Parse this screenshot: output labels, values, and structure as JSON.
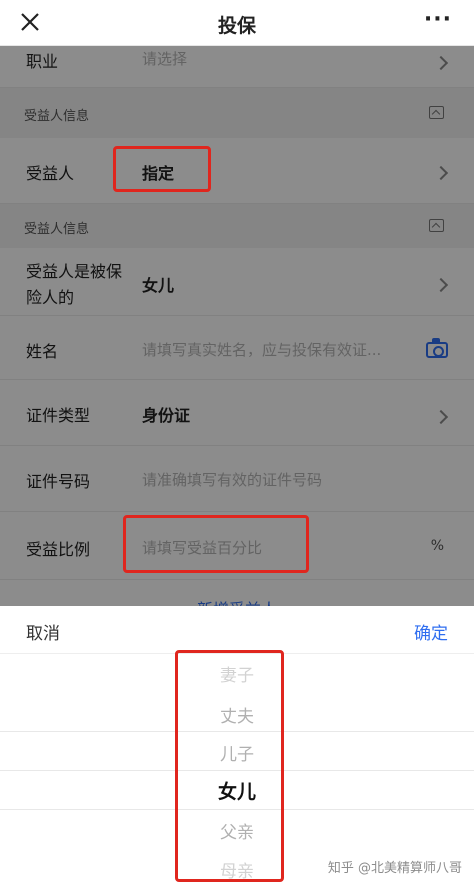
{
  "header": {
    "title": "投保",
    "close_icon": "close-icon",
    "more_icon": "more-icon",
    "more_label": "···"
  },
  "form": {
    "occupation": {
      "label": "职业",
      "placeholder": "请选择"
    },
    "section1": {
      "title": "受益人信息"
    },
    "beneficiary": {
      "label": "受益人",
      "value": "指定"
    },
    "section2": {
      "title": "受益人信息"
    },
    "relation": {
      "label_line1": "受益人是被保",
      "label_line2": "险人的",
      "value": "女儿"
    },
    "name": {
      "label": "姓名",
      "placeholder": "请填写真实姓名，应与投保有效证..."
    },
    "id_type": {
      "label": "证件类型",
      "value": "身份证"
    },
    "id_number": {
      "label": "证件号码",
      "placeholder": "请准确填写有效的证件号码"
    },
    "ratio": {
      "label": "受益比例",
      "placeholder": "请填写受益百分比",
      "unit": "%"
    },
    "add_beneficiary": "新增受益人"
  },
  "picker": {
    "cancel_label": "取消",
    "confirm_label": "确定",
    "options": [
      "妻子",
      "丈夫",
      "儿子",
      "女儿",
      "父亲",
      "母亲"
    ],
    "selected": "女儿"
  },
  "watermark": "知乎 @北美精算师八哥",
  "colors": {
    "accent": "#2f6ef0",
    "annotation": "#e0261e",
    "overlay": "rgba(0,0,0,0.45)"
  }
}
